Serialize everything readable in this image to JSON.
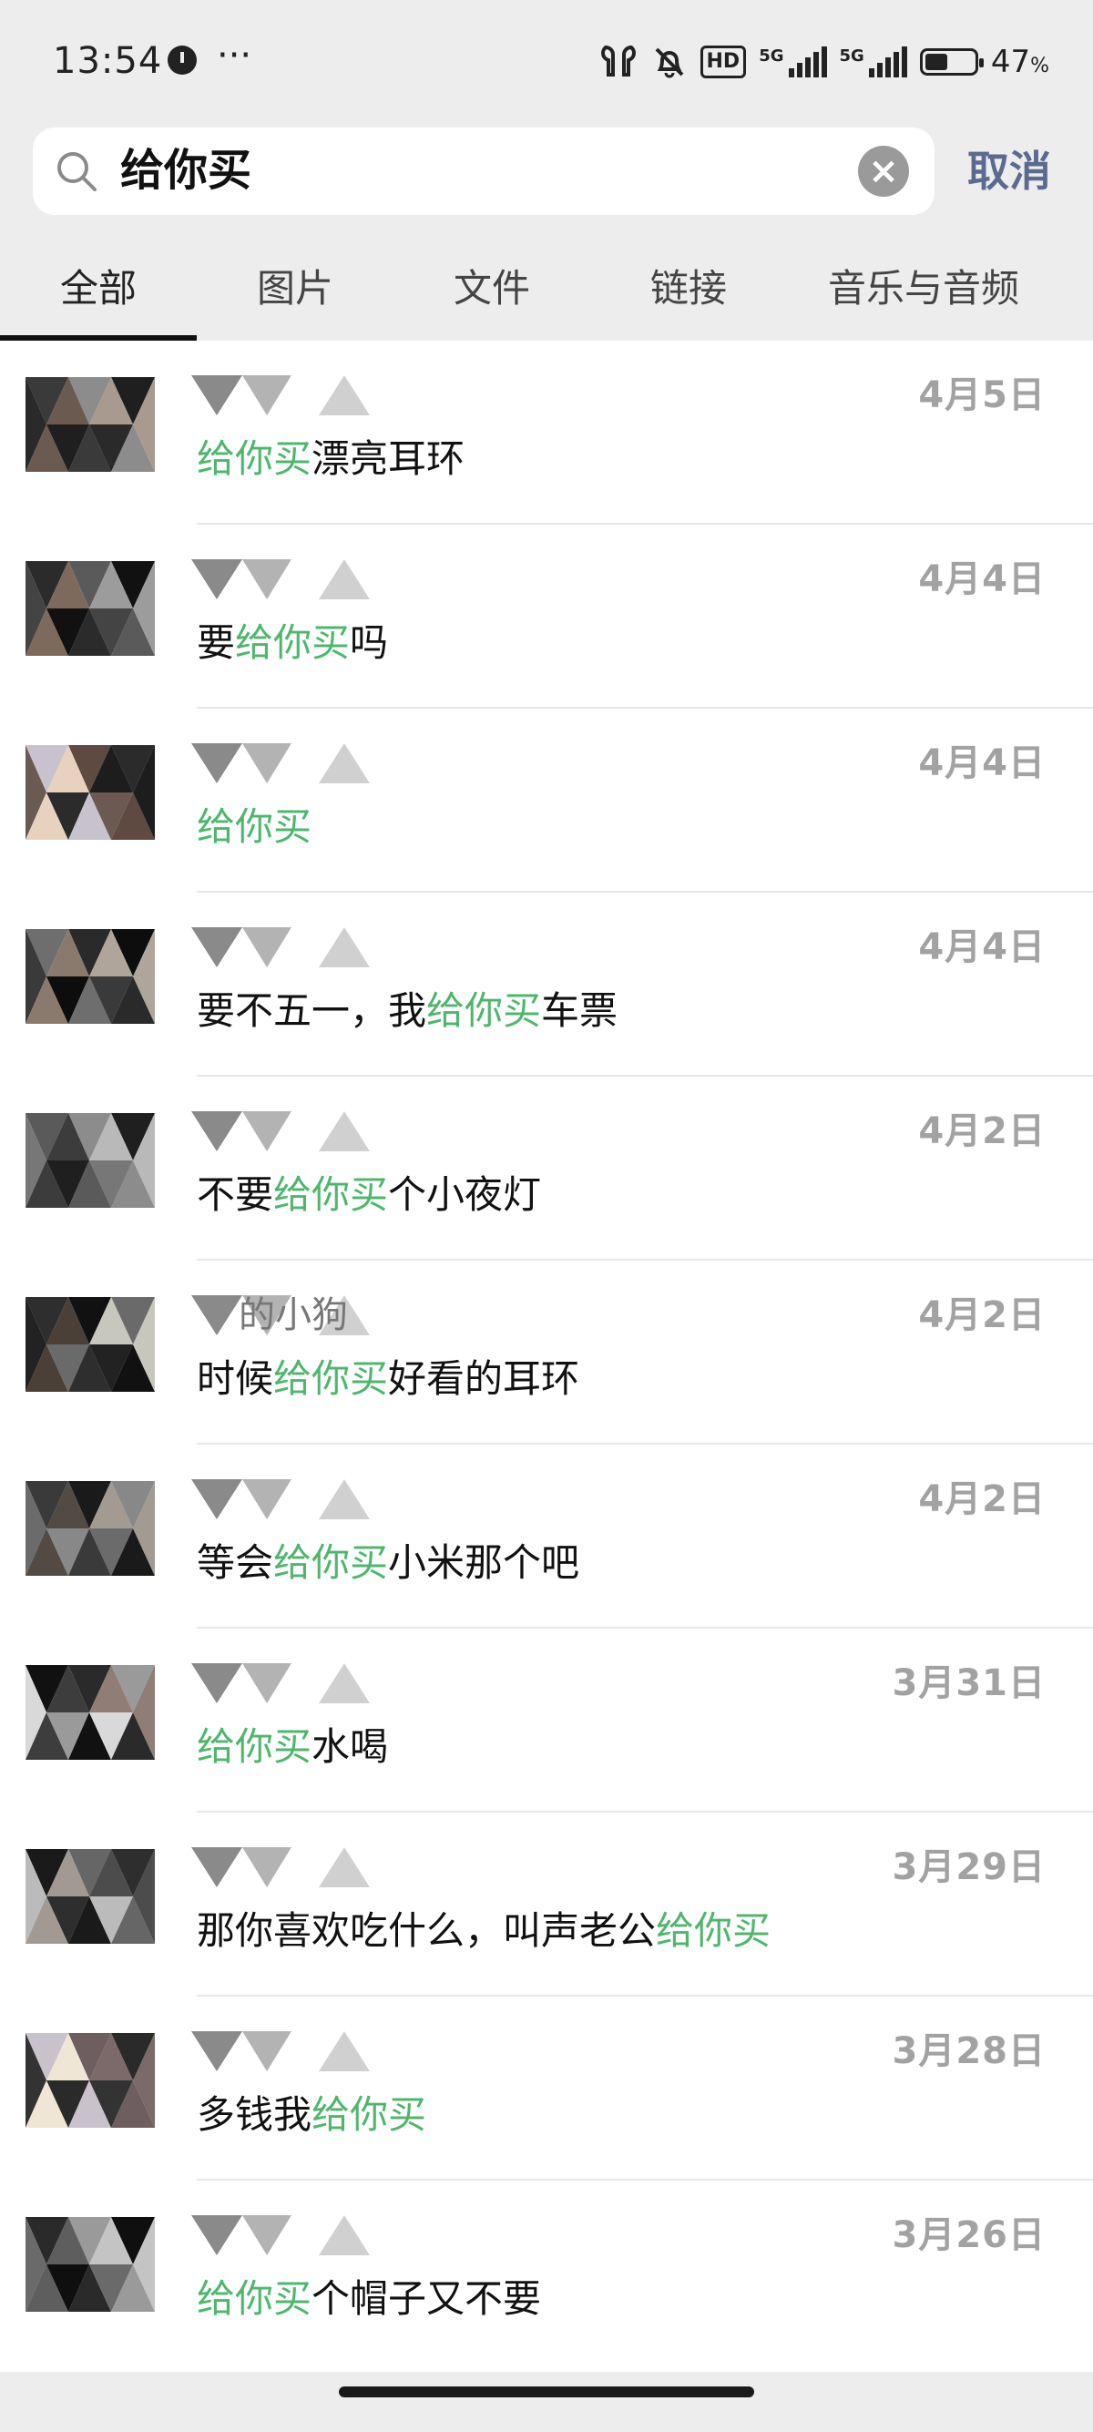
{
  "status_bar": {
    "time": "13:54",
    "dots": "···",
    "hd_label": "HD",
    "sim1_label": "5G",
    "sim2_label": "5G",
    "battery_percent": "47",
    "battery_unit": "%",
    "icons": [
      "clock-icon",
      "earbuds-icon",
      "bell-off-icon",
      "hd-icon",
      "signal-icon",
      "signal-icon",
      "battery-icon"
    ]
  },
  "search": {
    "query": "给你买",
    "cancel_label": "取消"
  },
  "tabs": [
    {
      "label": "全部",
      "active": true
    },
    {
      "label": "图片",
      "active": false
    },
    {
      "label": "文件",
      "active": false
    },
    {
      "label": "链接",
      "active": false
    },
    {
      "label": "音乐与音频",
      "active": false
    }
  ],
  "colors": {
    "highlight": "#4fb76c",
    "cancel": "#5b6a8f",
    "date": "#a2a2a2",
    "background": "#ededed"
  },
  "results": [
    {
      "name": "",
      "date": "4月5日",
      "pre": "",
      "hl": "给你买",
      "post": "漂亮耳环"
    },
    {
      "name": "",
      "date": "4月4日",
      "pre": "要",
      "hl": "给你买",
      "post": "吗"
    },
    {
      "name": "",
      "date": "4月4日",
      "pre": "",
      "hl": "给你买",
      "post": ""
    },
    {
      "name": "",
      "date": "4月4日",
      "pre": "要不五一，我",
      "hl": "给你买",
      "post": "车票"
    },
    {
      "name": "",
      "date": "4月2日",
      "pre": "不要",
      "hl": "给你买",
      "post": "个小夜灯"
    },
    {
      "name": "的小狗",
      "date": "4月2日",
      "pre": "时候",
      "hl": "给你买",
      "post": "好看的耳环"
    },
    {
      "name": "",
      "date": "4月2日",
      "pre": "等会",
      "hl": "给你买",
      "post": "小米那个吧"
    },
    {
      "name": "",
      "date": "3月31日",
      "pre": "",
      "hl": "给你买",
      "post": "水喝"
    },
    {
      "name": "",
      "date": "3月29日",
      "pre": "那你喜欢吃什么，叫声老公",
      "hl": "给你买",
      "post": ""
    },
    {
      "name": "",
      "date": "3月28日",
      "pre": "多钱我",
      "hl": "给你买",
      "post": ""
    },
    {
      "name": "",
      "date": "3月26日",
      "pre": "",
      "hl": "给你买",
      "post": "个帽子又不要"
    }
  ]
}
